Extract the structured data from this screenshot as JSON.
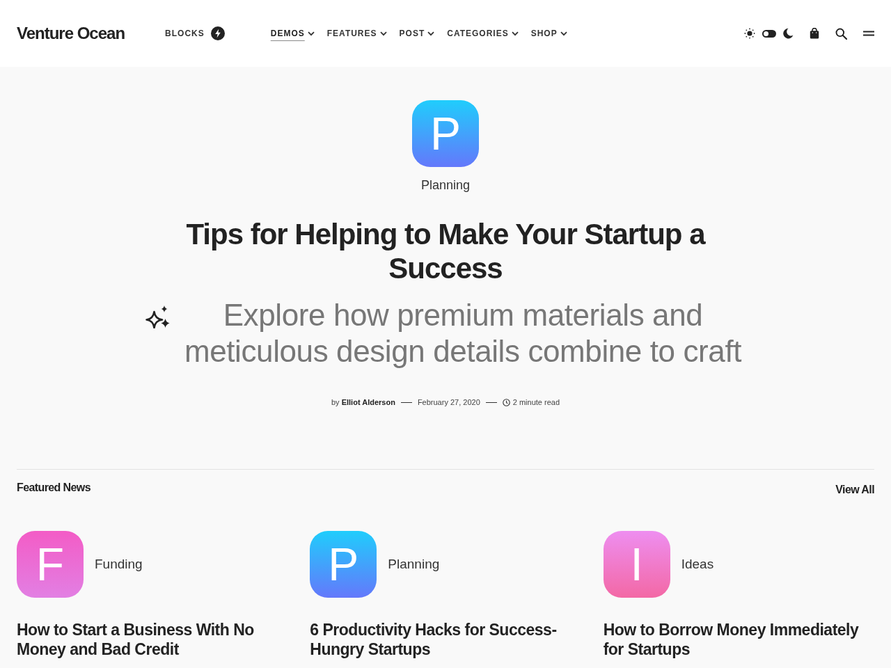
{
  "header": {
    "logo": "Venture Ocean",
    "blocks_link": {
      "label": "BLOCKS"
    },
    "nav": [
      {
        "label": "DEMOS",
        "selected": true
      },
      {
        "label": "FEATURES",
        "selected": false
      },
      {
        "label": "POST",
        "selected": false
      },
      {
        "label": "CATEGORIES",
        "selected": false
      },
      {
        "label": "SHOP",
        "selected": false
      }
    ],
    "theme_toggle": {
      "on": false
    }
  },
  "hero": {
    "category": {
      "letter": "P",
      "label": "Planning",
      "gradient": [
        {
          "color": "#20cdfc"
        },
        {
          "color": "#6478fb"
        }
      ]
    },
    "title": "Tips for Helping to Make Your Startup a Success",
    "subtitle": "Explore how premium materials and meticulous design details combine to craft",
    "byline": "by **Elliot Alderson**",
    "date": "February 27, 2020",
    "read_time": "2 minute read"
  },
  "featured": {
    "heading": "Featured News",
    "view_all": "View All",
    "cards": [
      {
        "letter": "F",
        "category": "Funding",
        "gradient": [
          {
            "color": "#f35cc6"
          },
          {
            "color": "#e27fe3"
          }
        ],
        "title": "How to Start a Business With No Money and Bad Credit"
      },
      {
        "letter": "P",
        "category": "Planning",
        "gradient": [
          {
            "color": "#20cdfc"
          },
          {
            "color": "#6478fb"
          }
        ],
        "title": "6 Productivity Hacks for Success-Hungry Startups"
      },
      {
        "letter": "I",
        "category": "Ideas",
        "gradient": [
          {
            "color": "#ee8ef0"
          },
          {
            "color": "#f368a5"
          }
        ],
        "title": "How to Borrow Money Immediately for Startups"
      }
    ]
  }
}
